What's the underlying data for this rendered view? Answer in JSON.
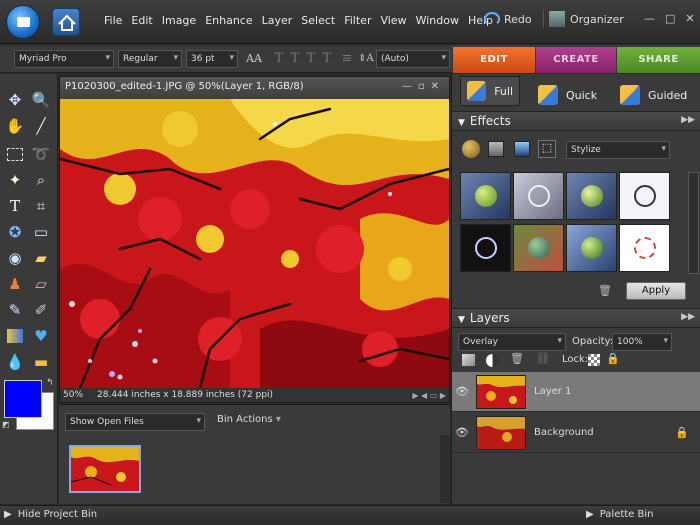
{
  "menubar": {
    "menus": [
      "File",
      "Edit",
      "Image",
      "Enhance",
      "Layer",
      "Select",
      "Filter",
      "View",
      "Window",
      "Help"
    ],
    "redo_label": "Redo",
    "organizer_label": "Organizer"
  },
  "options_bar": {
    "font_family": "Myriad Pro",
    "font_style": "Regular",
    "font_size": "36 pt",
    "leading": "(Auto)"
  },
  "mode_tabs": [
    {
      "label": "EDIT",
      "color": "#e7561a"
    },
    {
      "label": "CREATE",
      "color": "#9a2e7a"
    },
    {
      "label": "SHARE",
      "color": "#5a9a2e"
    }
  ],
  "document": {
    "title": "P1020300_edited-1.JPG @ 50%(Layer 1, RGB/8)",
    "zoom": "50%",
    "dimensions": "28.444 inches x 18.889 inches (72 ppi)"
  },
  "project_bin": {
    "show_select": "Show Open Files",
    "bin_actions": "Bin Actions",
    "hide_label": "Hide Project Bin"
  },
  "edit_views": [
    "Full",
    "Quick",
    "Guided"
  ],
  "effects": {
    "title": "Effects",
    "category": "Stylize",
    "apply_label": "Apply"
  },
  "layers": {
    "title": "Layers",
    "blend_mode": "Overlay",
    "opacity_label": "Opacity:",
    "opacity_value": "100%",
    "lock_label": "Lock:",
    "items": [
      {
        "name": "Layer 1",
        "selected": true
      },
      {
        "name": "Background",
        "selected": false,
        "locked": true
      }
    ]
  },
  "palette_bin_label": "Palette Bin",
  "colors": {
    "foreground": "#0000ff",
    "background": "#ffffff"
  }
}
